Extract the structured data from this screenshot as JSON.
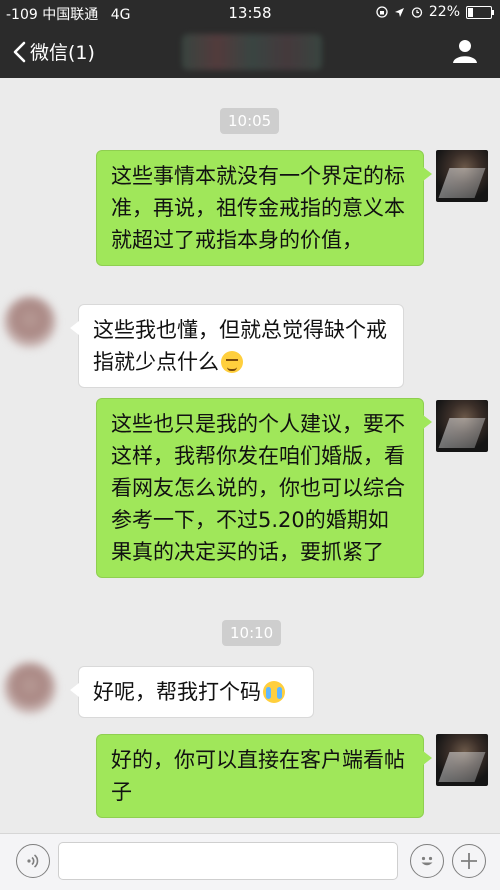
{
  "statusbar": {
    "signal": "-109",
    "carrier": "中国联通",
    "network": "4G",
    "time": "13:58",
    "battery": "22%",
    "battery_level": 0.22
  },
  "navbar": {
    "back_label": "微信(1)",
    "profile_icon": "person-icon"
  },
  "timestamps": [
    "10:05",
    "10:10"
  ],
  "messages": [
    {
      "sender": "me",
      "text": "这些事情本就没有一个界定的标准，再说，祖传金戒指的意义本就超过了戒指本身的价值，"
    },
    {
      "sender": "other",
      "text": "这些我也懂，但就总觉得缺个戒指就少点什么",
      "emoji": "sad-face-emoji"
    },
    {
      "sender": "me",
      "text": "这些也只是我的个人建议，要不这样，我帮你发在咱们婚版，看看网友怎么说的，你也可以综合参考一下，不过5.20的婚期如果真的决定买的话，要抓紧了"
    },
    {
      "sender": "other",
      "text": "好呢，帮我打个码",
      "emoji": "crying-face-emoji"
    },
    {
      "sender": "me",
      "text": "好的，你可以直接在客户端看帖子"
    }
  ],
  "inputbar": {
    "voice_icon": "voice-icon",
    "emoji_icon": "smiley-icon",
    "plus_icon": "plus-icon",
    "text_value": ""
  },
  "colors": {
    "bar_bg": "#2b2b2b",
    "chat_bg": "#ebebeb",
    "bubble_me": "#a0e75a",
    "bubble_other": "#ffffff",
    "timestamp_bg": "#cecece"
  }
}
